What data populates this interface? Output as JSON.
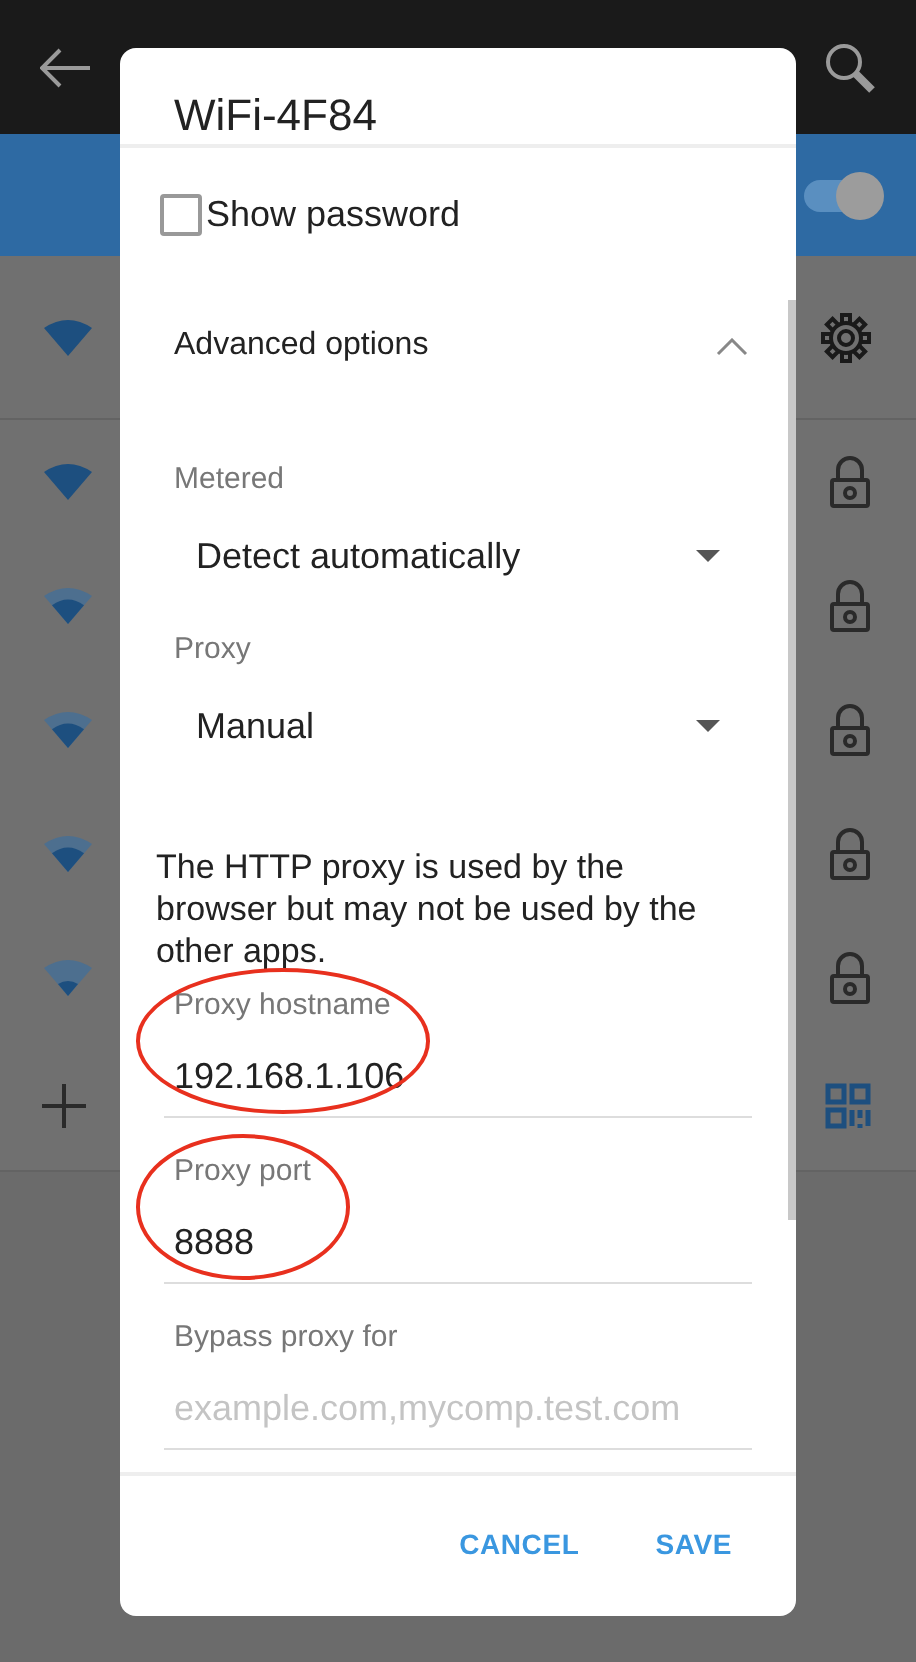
{
  "wifi_toggle": {
    "on": true
  },
  "networks": [
    {
      "kind": "strong",
      "connected": true
    },
    {
      "kind": "strong",
      "connected": false
    },
    {
      "kind": "medium",
      "connected": false
    },
    {
      "kind": "medium",
      "connected": false
    },
    {
      "kind": "medium",
      "connected": false
    },
    {
      "kind": "weak",
      "connected": false
    },
    {
      "kind": "add"
    }
  ],
  "dialog": {
    "title": "WiFi-4F84",
    "show_password": {
      "label": "Show password",
      "checked": false
    },
    "advanced": {
      "label": "Advanced options",
      "expanded": true
    },
    "fields": [
      {
        "kind": "dropdown",
        "label": "Metered",
        "value": "Detect automatically"
      },
      {
        "kind": "dropdown",
        "label": "Proxy",
        "value": "Manual"
      },
      {
        "kind": "note",
        "text": "The HTTP proxy is used by the browser but may not be used by the other apps."
      },
      {
        "kind": "input",
        "label": "Proxy hostname",
        "value": "192.168.1.106",
        "highlighted": true
      },
      {
        "kind": "input",
        "label": "Proxy port",
        "value": "8888",
        "highlighted": true
      },
      {
        "kind": "input",
        "label": "Bypass proxy for",
        "placeholder": "example.com,mycomp.test.com",
        "highlighted": false
      }
    ],
    "buttons": [
      {
        "label": "CANCEL"
      },
      {
        "label": "SAVE"
      }
    ]
  }
}
